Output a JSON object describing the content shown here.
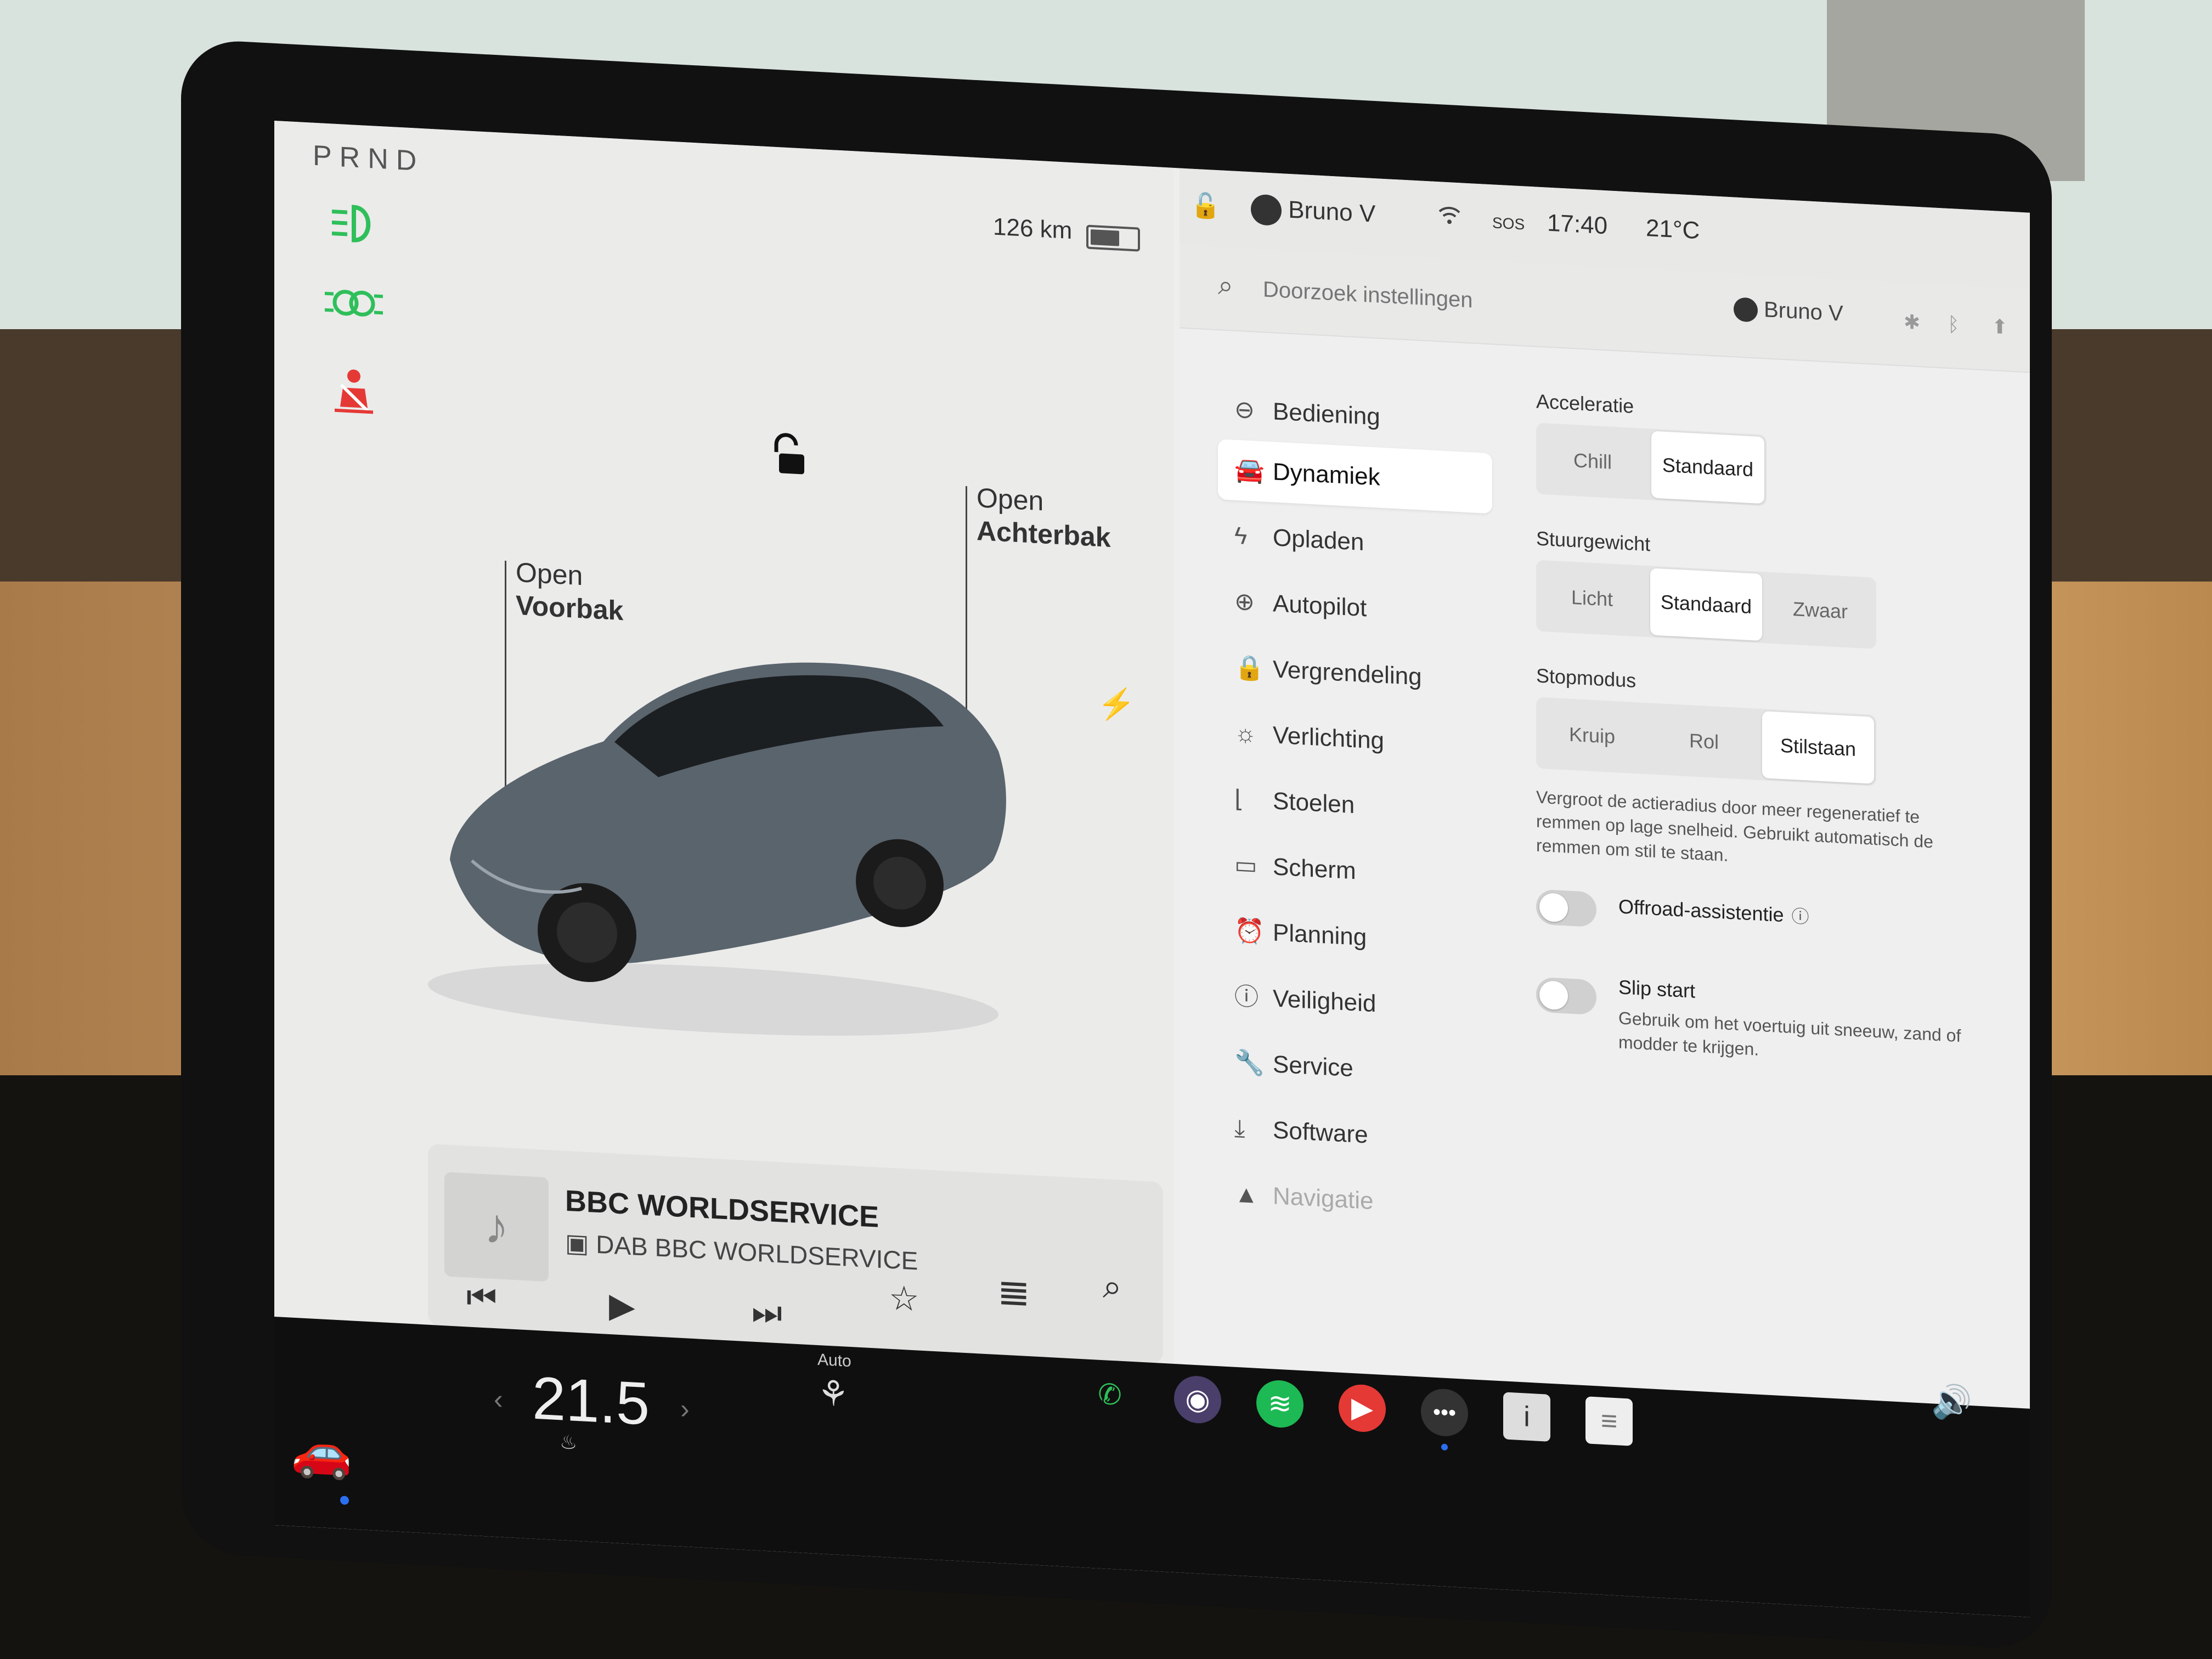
{
  "colors": {
    "screen_bg": "#eeeeed",
    "bottom_bar": "#0f0f0f",
    "accent_blue": "#2b6ff0",
    "green_indicator": "#2fbf5a",
    "red_seatbelt": "#e53935"
  },
  "car_panel": {
    "gear": "PRND",
    "range": "126 km",
    "tell_tales": [
      "headlight-icon",
      "parking-lights-icon",
      "seatbelt-warning-icon"
    ],
    "frunk_label_1": "Open",
    "frunk_label_2": "Voorbak",
    "trunk_label_1": "Open",
    "trunk_label_2": "Achterbak"
  },
  "media": {
    "title": "BBC WORLDSERVICE",
    "subtitle": "DAB BBC WORLDSERVICE"
  },
  "bottom_bar": {
    "temperature": "21.5",
    "seat_heat_label": "Auto",
    "apps": [
      "phone-icon",
      "camera-icon",
      "spotify-icon",
      "youtube-music-icon",
      "more-apps-icon",
      "info-app-icon",
      "notes-app-icon"
    ]
  },
  "status_bar": {
    "user": "Bruno V",
    "sos": "SOS",
    "time": "17:40",
    "outside_temp": "21°C"
  },
  "settings": {
    "search_placeholder": "Doorzoek instellingen",
    "profile_name": "Bruno V",
    "menu": [
      {
        "label": "Bediening",
        "icon": "toggle-icon"
      },
      {
        "label": "Dynamiek",
        "icon": "car-icon"
      },
      {
        "label": "Opladen",
        "icon": "bolt-icon"
      },
      {
        "label": "Autopilot",
        "icon": "steering-wheel-icon"
      },
      {
        "label": "Vergrendeling",
        "icon": "lock-icon"
      },
      {
        "label": "Verlichting",
        "icon": "light-icon"
      },
      {
        "label": "Stoelen",
        "icon": "seat-icon"
      },
      {
        "label": "Scherm",
        "icon": "screen-icon"
      },
      {
        "label": "Planning",
        "icon": "clock-icon"
      },
      {
        "label": "Veiligheid",
        "icon": "safety-icon"
      },
      {
        "label": "Service",
        "icon": "wrench-icon"
      },
      {
        "label": "Software",
        "icon": "download-icon"
      },
      {
        "label": "Navigatie",
        "icon": "navigation-icon"
      }
    ],
    "active_menu": "Dynamiek",
    "acceleration": {
      "title": "Acceleratie",
      "options": [
        "Chill",
        "Standaard"
      ],
      "selected": "Standaard"
    },
    "steering": {
      "title": "Stuurgewicht",
      "options": [
        "Licht",
        "Standaard",
        "Zwaar"
      ],
      "selected": "Standaard"
    },
    "stop_mode": {
      "title": "Stopmodus",
      "options": [
        "Kruip",
        "Rol",
        "Stilstaan"
      ],
      "selected": "Stilstaan",
      "description": "Vergroot de actieradius door meer regeneratief te remmen op lage snelheid. Gebruikt automatisch de remmen om stil te staan."
    },
    "offroad": {
      "label": "Offroad-assistentie",
      "enabled": false
    },
    "slip_start": {
      "label": "Slip start",
      "description": "Gebruik om het voertuig uit sneeuw, zand of modder te krijgen.",
      "enabled": false
    }
  }
}
